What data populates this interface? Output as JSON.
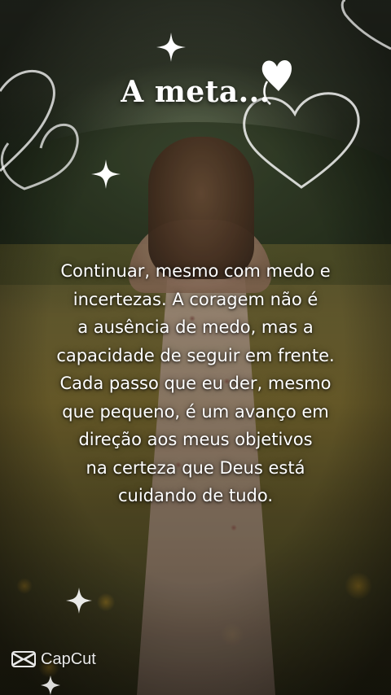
{
  "title": "A meta...",
  "quote_lines": [
    "Continuar, mesmo com medo e",
    "incertezas. A coragem não é",
    "a ausência de medo, mas a",
    "capacidade de seguir em frente.",
    "Cada passo que eu der, mesmo",
    "que pequeno, é um avanço em",
    "direção aos meus objetivos",
    "na certeza que Deus está",
    "cuidando de tudo."
  ],
  "watermark": {
    "icon": "capcut-logo-icon",
    "label": "CapCut"
  },
  "colors": {
    "text": "#ffffff",
    "flowers": "#e2aa28"
  }
}
